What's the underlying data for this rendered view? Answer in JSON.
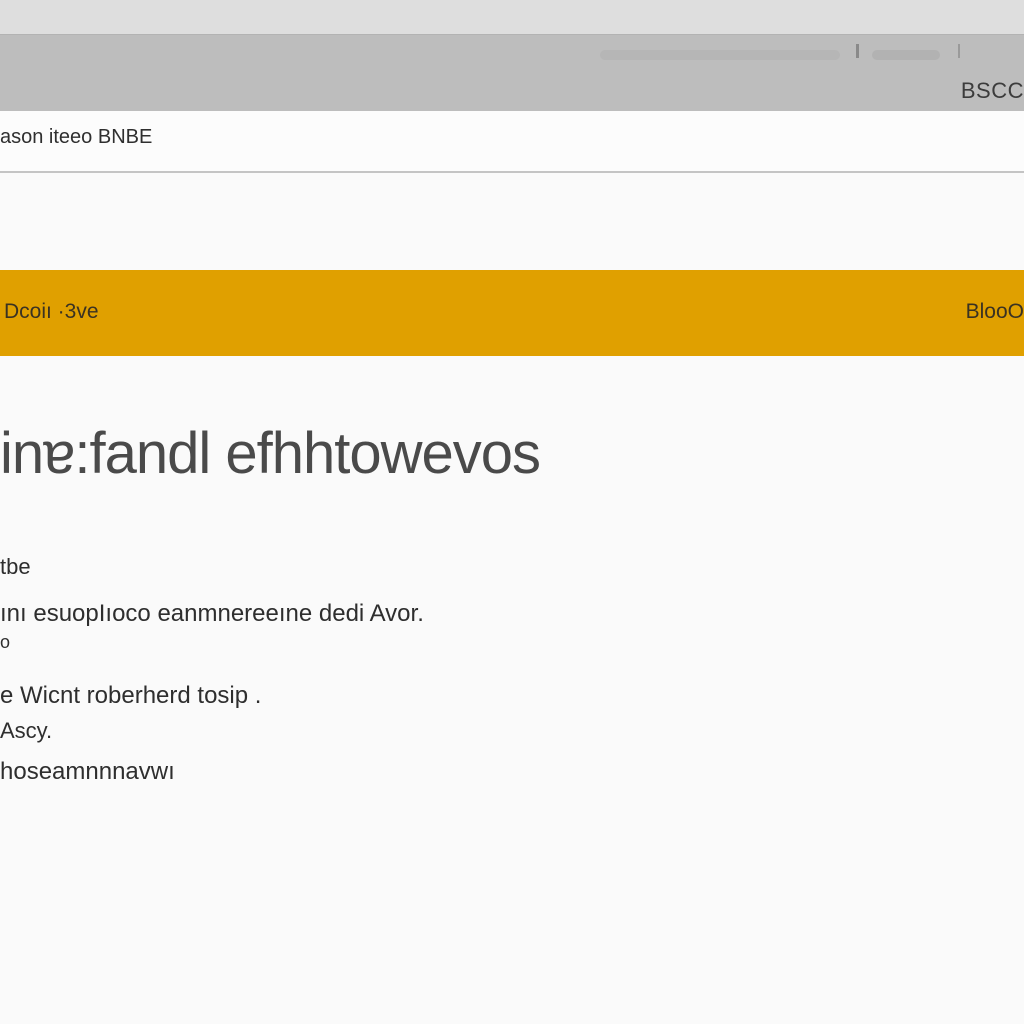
{
  "toolbar": {
    "action_label": "BSCC"
  },
  "address_bar": {
    "text": "ason iteeo BNBE"
  },
  "banner": {
    "color": "#e0a000",
    "left_label": "Dcoiı ·3ve",
    "right_label": "BlooO"
  },
  "main": {
    "headline": "inɐ:fandl efhhtowevos",
    "lines": [
      "tbe",
      "ını esuopIıoco eanmnereeıne dedi Avor.",
      "o",
      "e Wicnt roberherd tosip .",
      "Ascy.",
      "hoseamnnnavwı"
    ]
  }
}
